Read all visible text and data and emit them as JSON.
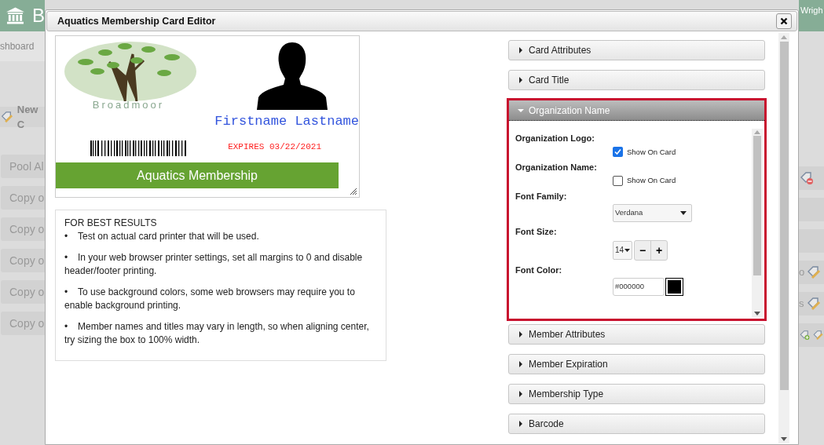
{
  "background_page": {
    "header_title": "B",
    "user_name": "Wrigh",
    "breadcrumb": "shboard",
    "new_button": "New C",
    "list_items": [
      {
        "label": "Pool Al",
        "icons": [
          {
            "kind": "remove"
          }
        ]
      },
      {
        "label": "Copy o"
      },
      {
        "label": "Copy o"
      },
      {
        "label": "Copy o",
        "trailing_text": "o",
        "icons": [
          {
            "kind": "edit"
          }
        ]
      },
      {
        "label": "Copy o",
        "trailing_text": "s",
        "icons": [
          {
            "kind": "edit"
          }
        ]
      },
      {
        "label": "Copy o",
        "icons": [
          {
            "kind": "add"
          },
          {
            "kind": "edit"
          }
        ]
      }
    ]
  },
  "dialog": {
    "title": "Aquatics Membership Card Editor",
    "card": {
      "organization_name": "Broadmoor",
      "member_name": "Firstname Lastname",
      "expires": "EXPIRES 03/22/2021",
      "membership_type": "Aquatics Membership"
    },
    "tips": {
      "title": "FOR BEST RESULTS",
      "items": [
        {
          "bullet": "•",
          "text": "Test on actual card printer that will be used."
        },
        {
          "bullet": "•",
          "text": "In your web browser printer settings, set all margins to 0 and disable header/footer printing."
        },
        {
          "bullet": "•",
          "text": "To use background colors, some web browsers may require you to enable background printing."
        },
        {
          "bullet": "•",
          "text": "Member names and titles may vary in length, so when aligning center, try sizing the box to 100% width."
        }
      ]
    },
    "sections": [
      {
        "label": "Card Attributes",
        "expanded": false
      },
      {
        "label": "Card Title",
        "expanded": false
      },
      {
        "label": "Organization Name",
        "expanded": true,
        "fields": [
          {
            "kind": "checkbox",
            "label": "Organization Logo:",
            "option": "Show On Card",
            "checked": true
          },
          {
            "kind": "checkbox",
            "label": "Organization Name:",
            "option": "Show On Card",
            "checked": false
          },
          {
            "kind": "select",
            "label": "Font Family:",
            "value": "Verdana"
          },
          {
            "kind": "stepper",
            "label": "Font Size:",
            "value": "14",
            "minus": "−",
            "plus": "+"
          },
          {
            "kind": "color",
            "label": "Font Color:",
            "value": "#000000",
            "color": "#000000"
          }
        ]
      },
      {
        "label": "Member Attributes",
        "expanded": false
      },
      {
        "label": "Member Expiration",
        "expanded": false
      },
      {
        "label": "Membership Type",
        "expanded": false
      },
      {
        "label": "Barcode",
        "expanded": false
      }
    ]
  }
}
